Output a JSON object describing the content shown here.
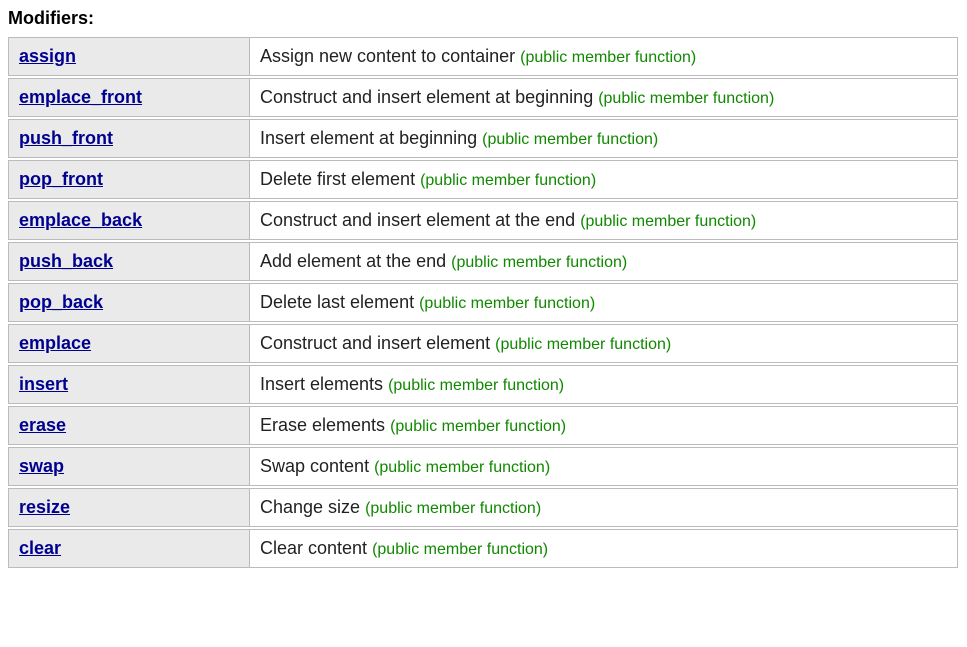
{
  "section": {
    "title": "Modifiers:"
  },
  "annotation": "(public member function)",
  "rows": [
    {
      "name": "assign",
      "desc": "Assign new content to container "
    },
    {
      "name": "emplace_front",
      "desc": "Construct and insert element at beginning "
    },
    {
      "name": "push_front",
      "desc": "Insert element at beginning "
    },
    {
      "name": "pop_front",
      "desc": "Delete first element "
    },
    {
      "name": "emplace_back",
      "desc": "Construct and insert element at the end "
    },
    {
      "name": "push_back",
      "desc": "Add element at the end "
    },
    {
      "name": "pop_back",
      "desc": "Delete last element "
    },
    {
      "name": "emplace",
      "desc": "Construct and insert element "
    },
    {
      "name": "insert",
      "desc": "Insert elements "
    },
    {
      "name": "erase",
      "desc": "Erase elements "
    },
    {
      "name": "swap",
      "desc": "Swap content "
    },
    {
      "name": "resize",
      "desc": "Change size "
    },
    {
      "name": "clear",
      "desc": "Clear content "
    }
  ]
}
